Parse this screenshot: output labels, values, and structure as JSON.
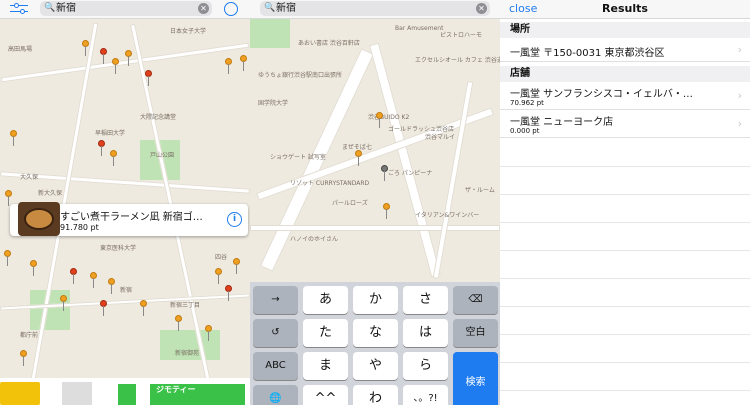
{
  "panel1": {
    "search_query": "新宿",
    "map_labels": [
      "高田馬場",
      "日本女子大学",
      "大隈記念講堂",
      "早稲田大学",
      "新大久保",
      "大久保",
      "新宿",
      "新宿三丁目",
      "新宿御苑",
      "都庁前",
      "四谷",
      "東京医科大学",
      "戸山公園"
    ],
    "callout": {
      "name": "すごい煮干ラーメン凪 新宿ゴ…",
      "points": "91.780 pt"
    },
    "ad_text": "ジモティー"
  },
  "panel2": {
    "search_query": "新宿",
    "map_labels": [
      "Bar Amusement",
      "あおい書店 渋谷百軒店",
      "ピストロハーモ",
      "ゆうちょ銀行渋谷駅南口出張所",
      "エクセルシオール カフェ 渋谷道玄坂",
      "国学院大学",
      "渋谷BUIDO K2",
      "ゴールドラッシュ渋谷店",
      "まぜそば七",
      "ショウゲート 試写室",
      "ごろ パンピーナ",
      "リゾット CURRYSTANDARD",
      "パールローズ",
      "ハノイのホイさん",
      "イタリアン&ワインバー",
      "渋谷マルイ",
      "ザ・ルーム"
    ],
    "keyboard": {
      "rows": [
        [
          "→",
          "あ",
          "か",
          "さ",
          "⌫"
        ],
        [
          "↺",
          "た",
          "な",
          "は",
          "空白"
        ],
        [
          "ABC",
          "ま",
          "や",
          "ら",
          "検索"
        ],
        [
          "🌐",
          "^^",
          "わ",
          "、。?!",
          ""
        ]
      ]
    }
  },
  "panel3": {
    "close_label": "close",
    "title": "Results",
    "sections": [
      {
        "header": "場所",
        "rows": [
          {
            "name": "一風堂 〒150-0031 東京都渋谷区",
            "points": ""
          }
        ]
      },
      {
        "header": "店舗",
        "rows": [
          {
            "name": "一風堂 サンフランシスコ・イェルバ・…",
            "points": "70.962 pt"
          },
          {
            "name": "一風堂 ニューヨーク店",
            "points": "0.000 pt"
          }
        ]
      }
    ]
  },
  "colors": {
    "accent": "#1e7bf0",
    "pin_orange": "#f0a020",
    "pin_red": "#e0401c",
    "map_bg": "#efeae0",
    "park": "#bfe3b4"
  }
}
